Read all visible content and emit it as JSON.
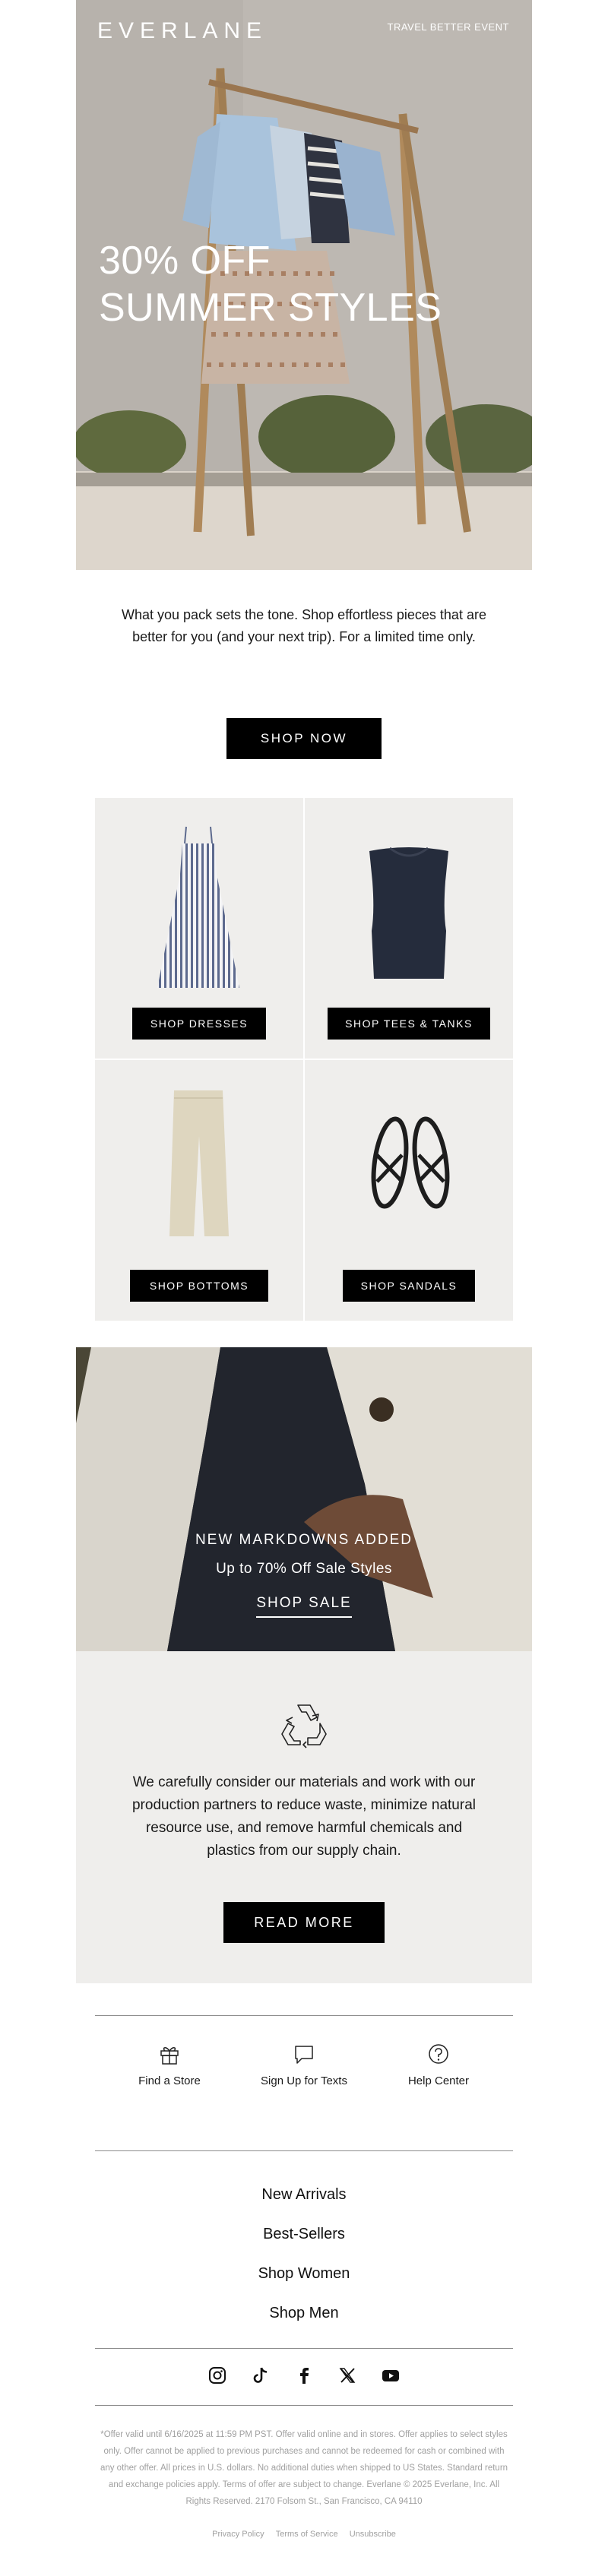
{
  "header": {
    "logo": "EVERLANE",
    "event": "TRAVEL BETTER EVENT"
  },
  "hero": {
    "headline_line1": "30% OFF",
    "headline_line2": "SUMMER STYLES"
  },
  "intro": {
    "text": "What you pack sets the tone. Shop effortless pieces that are better for you (and your next trip). For a limited time only.",
    "cta": "SHOP NOW"
  },
  "products": [
    {
      "label": "SHOP DRESSES",
      "icon": "striped-dress"
    },
    {
      "label": "SHOP TEES & TANKS",
      "icon": "navy-tank-top"
    },
    {
      "label": "SHOP BOTTOMS",
      "icon": "cream-trousers"
    },
    {
      "label": "SHOP SANDALS",
      "icon": "black-sandals"
    }
  ],
  "markdown": {
    "title": "NEW MARKDOWNS ADDED",
    "subtitle": "Up to 70% Off Sale Styles",
    "link": "SHOP SALE"
  },
  "sustain": {
    "icon": "recycle-icon",
    "text": "We carefully consider our materials and work with our production partners to reduce waste, minimize natural resource use, and remove harmful chemicals and plastics from our supply chain.",
    "cta": "READ MORE"
  },
  "utilities": [
    {
      "label": "Find a Store",
      "icon": "gift-icon"
    },
    {
      "label": "Sign Up for Texts",
      "icon": "chat-icon"
    },
    {
      "label": "Help Center",
      "icon": "help-icon"
    }
  ],
  "nav_links": [
    "New Arrivals",
    "Best-Sellers",
    "Shop Women",
    "Shop Men"
  ],
  "social": [
    "instagram-icon",
    "tiktok-icon",
    "facebook-icon",
    "x-icon",
    "youtube-icon"
  ],
  "legal": "*Offer valid until 6/16/2025 at 11:59 PM PST. Offer valid online and in stores. Offer applies to select styles only. Offer cannot be applied to previous purchases and cannot be redeemed for cash or combined with any other offer. All prices in U.S. dollars. No additional duties when shipped to US States. Standard return and exchange policies apply. Terms of offer are subject to change. Everlane © 2025 Everlane, Inc. All Rights Reserved. 2170 Folsom St., San Francisco, CA 94110",
  "footer_links": [
    "Privacy Policy",
    "Terms of Service",
    "Unsubscribe"
  ],
  "colors": {
    "black": "#000000",
    "panel": "#efeeec",
    "muted": "#a0a0a0"
  }
}
